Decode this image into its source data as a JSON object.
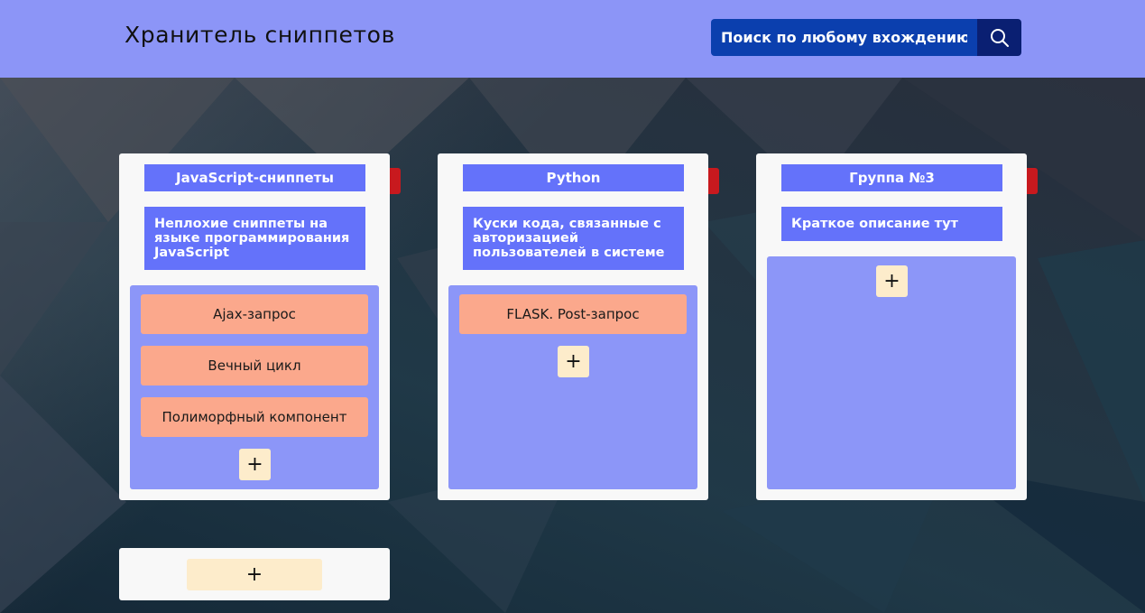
{
  "header": {
    "title": "Хранитель сниппетов",
    "search_placeholder": "Поиск по любому вхождению",
    "search_icon": "search-icon"
  },
  "groups": [
    {
      "title": "JavaScript-сниппеты",
      "description": "Неплохие сниппеты на языке программирования JavaScript",
      "snippets": [
        "Ajax-запрос",
        "Вечный цикл",
        "Полиморфный компонент"
      ],
      "add_label": "+"
    },
    {
      "title": "Python",
      "description": "Куски кода, связанные с авторизацией пользователей в системе",
      "snippets": [
        "FLASK. Post-запрос"
      ],
      "add_label": "+"
    },
    {
      "title": "Группа №3",
      "description": "Краткое описание тут",
      "snippets": [],
      "add_label": "+"
    }
  ],
  "new_group": {
    "label": "+"
  },
  "colors": {
    "header_bg": "#8c95f7",
    "search_bg": "#0b3fae",
    "search_button_bg": "#0a1f72",
    "card_title_bg": "#6472fa",
    "snippet_area_bg": "#8c96f8",
    "snippet_bg": "#fba88c",
    "add_button_bg": "#fdeccb",
    "delete_tab_bg": "#c8191e"
  }
}
